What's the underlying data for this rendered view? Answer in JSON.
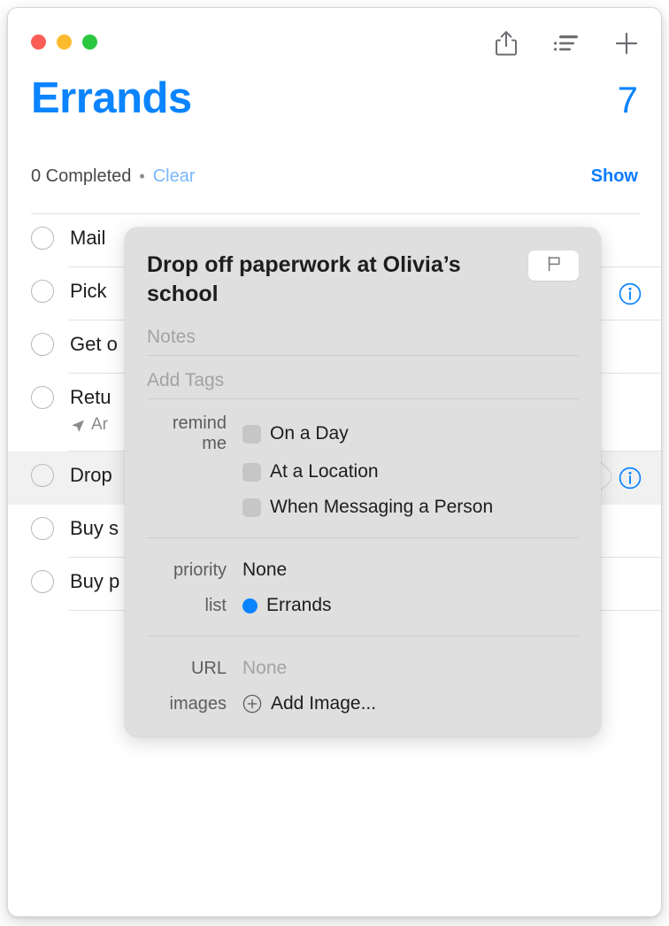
{
  "window": {
    "traffic_lights": [
      {
        "name": "close",
        "color": "#FA5E57"
      },
      {
        "name": "minimize",
        "color": "#FCBB2F"
      },
      {
        "name": "maximize",
        "color": "#2BC740"
      }
    ],
    "toolbar": [
      {
        "name": "share-icon",
        "label": "Share"
      },
      {
        "name": "list-view-icon",
        "label": "View Options"
      },
      {
        "name": "add-icon",
        "label": "Add Reminder"
      }
    ]
  },
  "header": {
    "title": "Errands",
    "count": "7",
    "completed_text": "0 Completed",
    "separator": "•",
    "clear_label": "Clear",
    "show_label": "Show",
    "accent_color": "#0a84ff"
  },
  "reminders": [
    {
      "title": "Mail",
      "subtitle": "",
      "selected": false,
      "info": false
    },
    {
      "title": "Pick",
      "subtitle": "",
      "selected": false,
      "info": true
    },
    {
      "title": "Get o",
      "subtitle": "",
      "selected": false,
      "info": false
    },
    {
      "title": "Retu",
      "subtitle": "Ar",
      "selected": false,
      "info": false,
      "has_location": true
    },
    {
      "title": "Drop",
      "subtitle": "",
      "selected": true,
      "info": true
    },
    {
      "title": "Buy s",
      "subtitle": "",
      "selected": false,
      "info": false
    },
    {
      "title": "Buy p",
      "subtitle": "",
      "selected": false,
      "info": false
    }
  ],
  "popover": {
    "title": "Drop off paperwork at Olivia’s school",
    "flag_button": "flag-icon",
    "notes_placeholder": "Notes",
    "tags_placeholder": "Add Tags",
    "remind_me": {
      "label": "remind me",
      "options": [
        {
          "label": "On a Day",
          "checked": false
        },
        {
          "label": "At a Location",
          "checked": false
        },
        {
          "label": "When Messaging a Person",
          "checked": false
        }
      ]
    },
    "priority": {
      "label": "priority",
      "value": "None"
    },
    "list": {
      "label": "list",
      "value": "Errands",
      "color": "#0a84ff"
    },
    "url": {
      "label": "URL",
      "value": "None"
    },
    "images": {
      "label": "images",
      "value": "Add Image...",
      "icon": "plus-circle-icon"
    }
  }
}
